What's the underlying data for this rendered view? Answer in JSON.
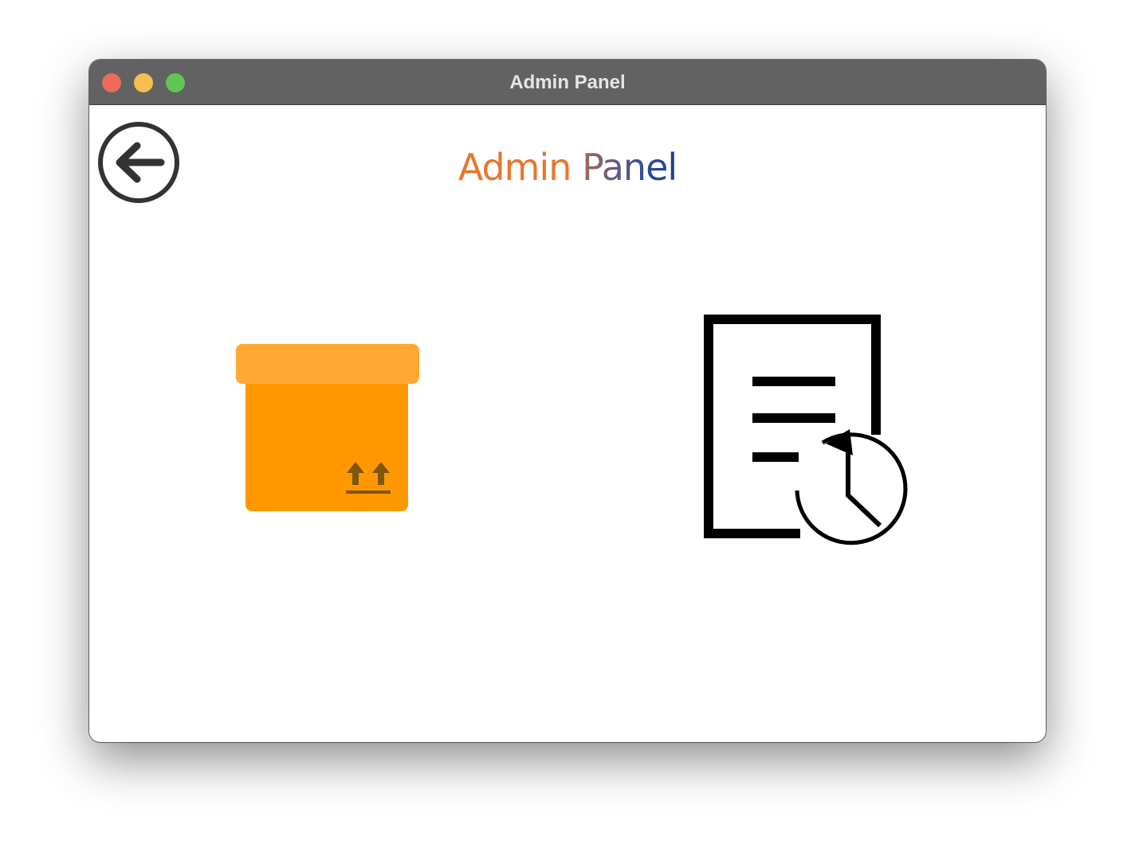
{
  "window": {
    "title": "Admin Panel"
  },
  "header": {
    "title_word1": "Admin",
    "title_word2": "Panel"
  },
  "icons": {
    "back": "arrow-left-circle-icon",
    "inventory": "package-box-icon",
    "history": "document-history-icon"
  },
  "colors": {
    "titlebar": "#616261",
    "close": "#ec6a5e",
    "minimize": "#f4bf4f",
    "maximize": "#61c554",
    "title_orange": "#e8762f",
    "title_blue": "#1c3f9b",
    "box_body": "#ff9800",
    "box_lid": "#ffa832"
  }
}
